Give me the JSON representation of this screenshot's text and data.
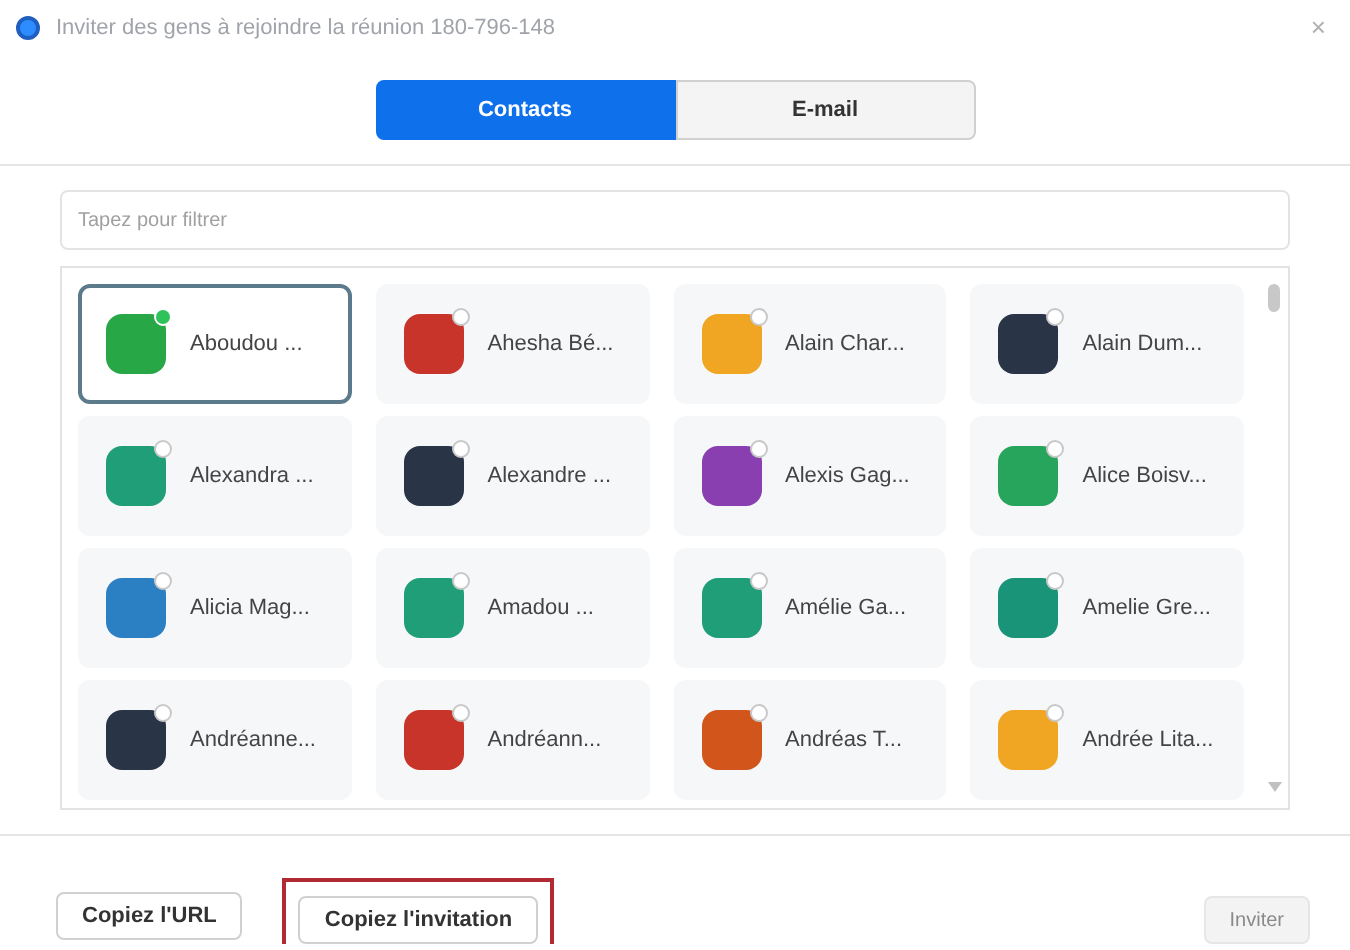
{
  "window": {
    "title": "Inviter des gens à rejoindre la réunion 180-796-148",
    "close": "×"
  },
  "tabs": [
    {
      "label": "Contacts",
      "selected": true
    },
    {
      "label": "E-mail",
      "selected": false
    }
  ],
  "filter": {
    "placeholder": "Tapez pour filtrer"
  },
  "contacts": [
    {
      "name": "Aboudou ...",
      "color": "#27a745",
      "selected": true,
      "online": true
    },
    {
      "name": "Ahesha Bé...",
      "color": "#c8342a",
      "selected": false,
      "online": false
    },
    {
      "name": "Alain Char...",
      "color": "#f0a622",
      "selected": false,
      "online": false
    },
    {
      "name": "Alain Dum...",
      "color": "#2a3447",
      "selected": false,
      "online": false
    },
    {
      "name": "Alexandra ...",
      "color": "#1f9e78",
      "selected": false,
      "online": false
    },
    {
      "name": "Alexandre ...",
      "color": "#2a3447",
      "selected": false,
      "online": false
    },
    {
      "name": "Alexis Gag...",
      "color": "#8a3fb0",
      "selected": false,
      "online": false
    },
    {
      "name": "Alice Boisv...",
      "color": "#28a55c",
      "selected": false,
      "online": false
    },
    {
      "name": "Alicia Mag...",
      "color": "#2b7fc3",
      "selected": false,
      "online": false
    },
    {
      "name": "Amadou ...",
      "color": "#1f9e78",
      "selected": false,
      "online": false
    },
    {
      "name": "Amélie Ga...",
      "color": "#1f9e78",
      "selected": false,
      "online": false
    },
    {
      "name": "Amelie Gre...",
      "color": "#1a9478",
      "selected": false,
      "online": false
    },
    {
      "name": "Andréanne...",
      "color": "#2a3447",
      "selected": false,
      "online": false
    },
    {
      "name": "Andréann...",
      "color": "#c8342a",
      "selected": false,
      "online": false
    },
    {
      "name": "Andréas T...",
      "color": "#d2561c",
      "selected": false,
      "online": false
    },
    {
      "name": "Andrée Lita...",
      "color": "#f0a622",
      "selected": false,
      "online": false
    }
  ],
  "buttons": [
    {
      "label": "Copiez l'URL",
      "highlighted": false
    },
    {
      "label": "Copiez l'invitation",
      "highlighted": true
    }
  ],
  "invite_button": {
    "label": "Inviter",
    "disabled": true
  }
}
